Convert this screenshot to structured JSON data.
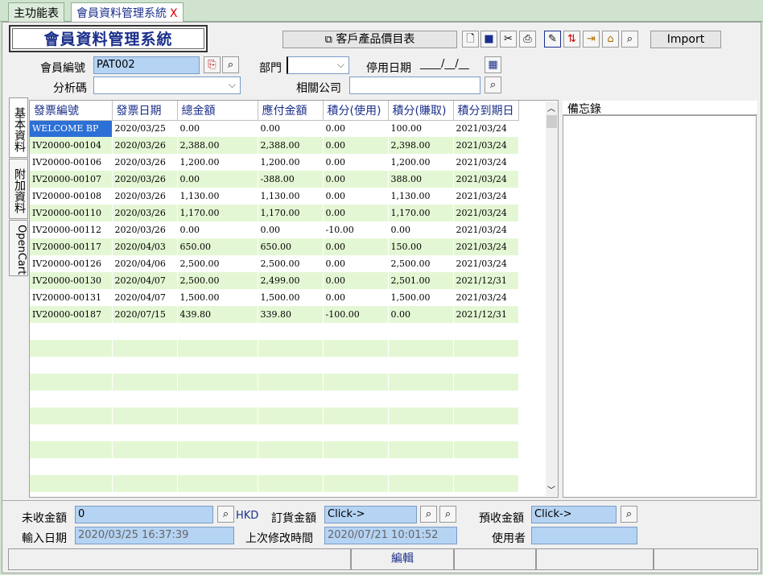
{
  "tabs": [
    {
      "label": "主功能表"
    },
    {
      "label": "會員資料管理系統",
      "close": "X"
    }
  ],
  "title": "會員資料管理系統",
  "toolbar": {
    "price_list_label": "客戶產品價目表",
    "import_label": "Import"
  },
  "form": {
    "member_no_label": "會員編號",
    "member_no_value": "PAT002",
    "dept_label": "部門",
    "dept_value": "",
    "stop_date_label": "停用日期",
    "stop_date_value": "____/__/__",
    "analysis_label": "分析碼",
    "analysis_value": "",
    "related_label": "相關公司",
    "related_value": ""
  },
  "side_tabs": [
    "基本資料",
    "附加資料",
    "OpenCart"
  ],
  "grid": {
    "columns": [
      "發票編號",
      "發票日期",
      "總金額",
      "應付金額",
      "積分(使用)",
      "積分(賺取)",
      "積分到期日"
    ],
    "rows": [
      [
        "WELCOME BP",
        "2020/03/25",
        "0.00",
        "0.00",
        "0.00",
        "100.00",
        "2021/03/24"
      ],
      [
        "IV20000-00104",
        "2020/03/26",
        "2,388.00",
        "2,388.00",
        "0.00",
        "2,398.00",
        "2021/03/24"
      ],
      [
        "IV20000-00106",
        "2020/03/26",
        "1,200.00",
        "1,200.00",
        "0.00",
        "1,200.00",
        "2021/03/24"
      ],
      [
        "IV20000-00107",
        "2020/03/26",
        "0.00",
        "-388.00",
        "0.00",
        "388.00",
        "2021/03/24"
      ],
      [
        "IV20000-00108",
        "2020/03/26",
        "1,130.00",
        "1,130.00",
        "0.00",
        "1,130.00",
        "2021/03/24"
      ],
      [
        "IV20000-00110",
        "2020/03/26",
        "1,170.00",
        "1,170.00",
        "0.00",
        "1,170.00",
        "2021/03/24"
      ],
      [
        "IV20000-00112",
        "2020/03/26",
        "0.00",
        "0.00",
        "-10.00",
        "0.00",
        "2021/03/24"
      ],
      [
        "IV20000-00117",
        "2020/04/03",
        "650.00",
        "650.00",
        "0.00",
        "150.00",
        "2021/03/24"
      ],
      [
        "IV20000-00126",
        "2020/04/06",
        "2,500.00",
        "2,500.00",
        "0.00",
        "2,500.00",
        "2021/03/24"
      ],
      [
        "IV20000-00130",
        "2020/04/07",
        "2,500.00",
        "2,499.00",
        "0.00",
        "2,501.00",
        "2021/12/31"
      ],
      [
        "IV20000-00131",
        "2020/04/07",
        "1,500.00",
        "1,500.00",
        "0.00",
        "1,500.00",
        "2021/03/24"
      ],
      [
        "IV20000-00187",
        "2020/07/15",
        "439.80",
        "339.80",
        "-100.00",
        "0.00",
        "2021/12/31"
      ]
    ]
  },
  "memo_label": "備忘錄",
  "footer": {
    "unpaid_label": "未收金額",
    "unpaid_value": "0",
    "currency": "HKD",
    "order_label": "訂貨金額",
    "order_value": "Click->",
    "prepaid_label": "預收金額",
    "prepaid_value": "Click->",
    "input_date_label": "輸入日期",
    "input_date_value": "2020/03/25 16:37:39",
    "last_modified_label": "上次修改時間",
    "last_modified_value": "2020/07/21 10:01:52",
    "user_label": "使用者",
    "user_value": ""
  },
  "status_bar": {
    "mode": "編輯"
  },
  "colors": {
    "accent": "#1a2f8a",
    "row_alt": "#e4f7d4",
    "selected": "#2c6fd6",
    "input_fill": "#b5d3f3"
  }
}
